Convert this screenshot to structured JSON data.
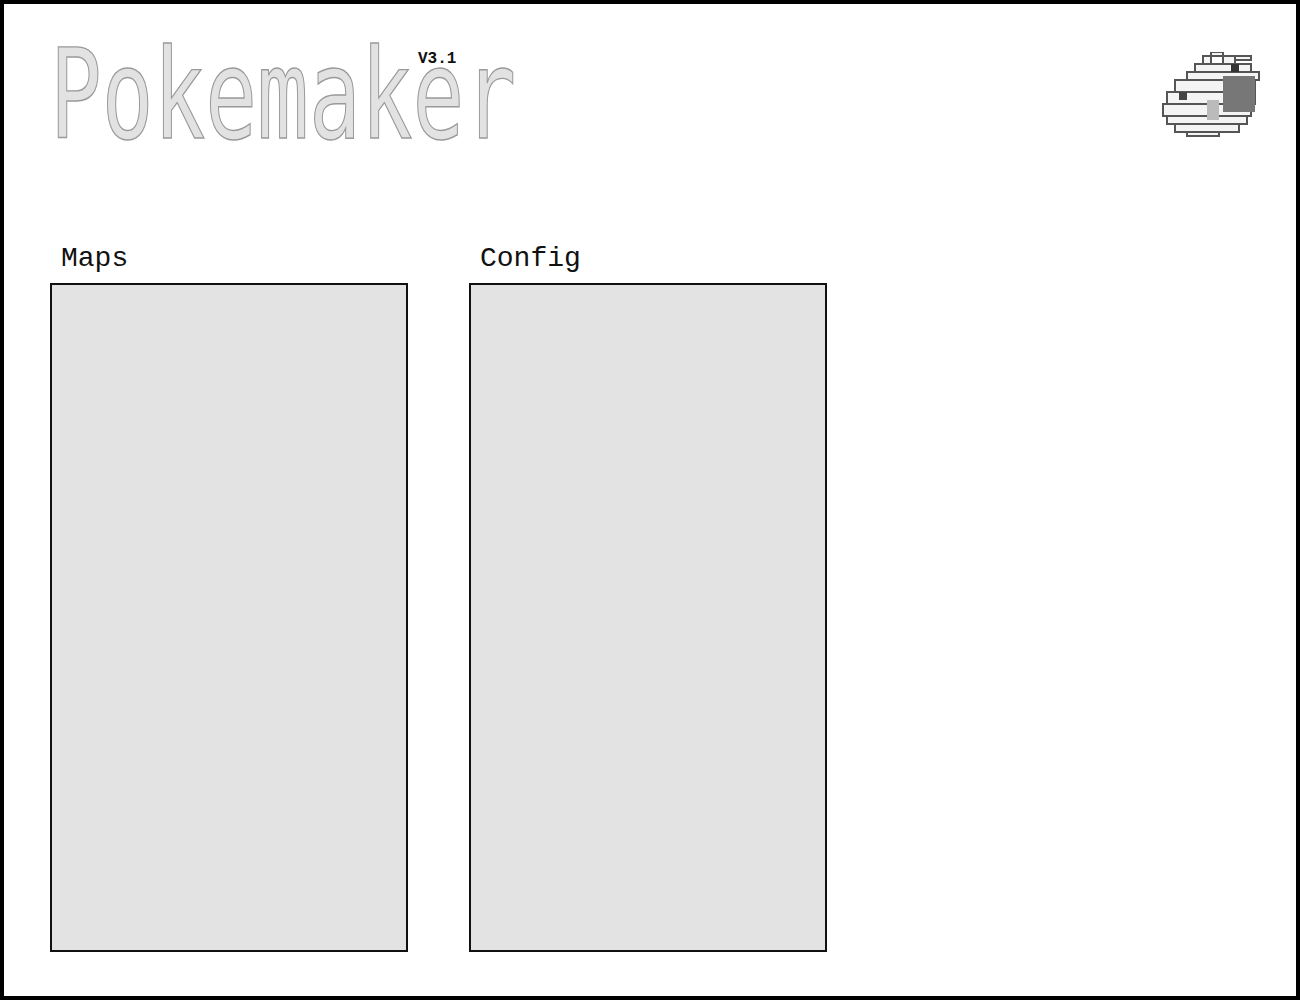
{
  "app": {
    "title": "Pokemaker",
    "version": "V3.1"
  },
  "panels": [
    {
      "label": "Maps"
    },
    {
      "label": "Config"
    }
  ]
}
